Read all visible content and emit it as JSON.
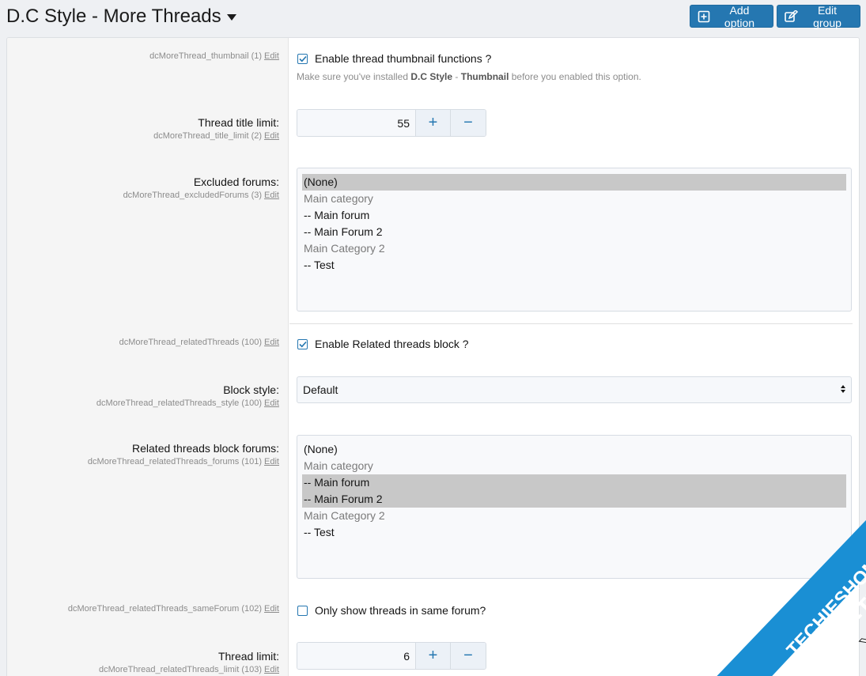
{
  "header": {
    "title": "D.C Style - More Threads",
    "add_option": "Add option",
    "edit_group": "Edit group"
  },
  "edit_label": "Edit",
  "rows": {
    "thumb": {
      "meta": "dcMoreThread_thumbnail (1)",
      "checkbox_label": "Enable thread thumbnail functions ?",
      "checked": true,
      "hint_pre": "Make sure you've installed ",
      "hint_b1": "D.C Style",
      "hint_mid": " - ",
      "hint_b2": "Thumbnail",
      "hint_post": " before you enabled this option."
    },
    "title_limit": {
      "label": "Thread title limit:",
      "meta": "dcMoreThread_title_limit (2)",
      "value": "55"
    },
    "excluded": {
      "label": "Excluded forums:",
      "meta": "dcMoreThread_excludedForums (3)",
      "options": [
        "(None)",
        "Main category",
        "-- Main forum",
        "-- Main Forum 2",
        "Main Category 2",
        "-- Test"
      ]
    },
    "related": {
      "meta": "dcMoreThread_relatedThreads (100)",
      "checkbox_label": "Enable Related threads block ?",
      "checked": true
    },
    "block_style": {
      "label": "Block style:",
      "meta": "dcMoreThread_relatedThreads_style (100)",
      "value": "Default"
    },
    "related_forums": {
      "label": "Related threads block forums:",
      "meta": "dcMoreThread_relatedThreads_forums (101)",
      "options": [
        "(None)",
        "Main category",
        "-- Main forum",
        "-- Main Forum 2",
        "Main Category 2",
        "-- Test"
      ]
    },
    "same_forum": {
      "meta": "dcMoreThread_relatedThreads_sameForum (102)",
      "checkbox_label": "Only show threads in same forum?",
      "checked": false
    },
    "thread_limit": {
      "label": "Thread limit:",
      "meta": "dcMoreThread_relatedThreads_limit (103)",
      "value": "6"
    }
  },
  "spin": {
    "plus": "+",
    "minus": "−"
  },
  "watermark": {
    "line1": "TECHIESHOME.COM",
    "line2": "XF-TECH",
    "line3": "XF-TECH"
  },
  "colors": {
    "accent": "#2577b1",
    "selected_option": "#c8c8c8",
    "watermark_bg": "#1a8fd4"
  }
}
